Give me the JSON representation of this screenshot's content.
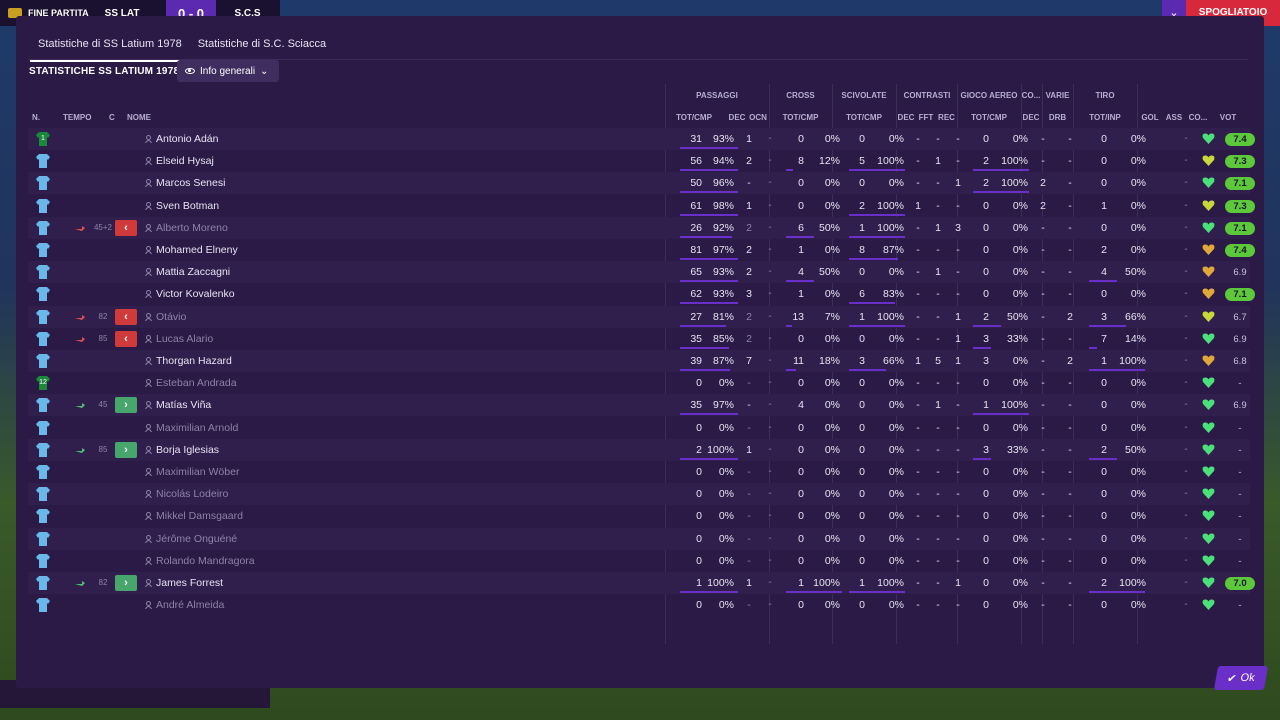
{
  "topbar": {
    "title": "FINE PARTITA",
    "home": "SS LAT",
    "score": "0 - 0",
    "away": "S.C.S",
    "skip": "SPOGLIATOIO"
  },
  "tabs": [
    "Statistiche di SS Latium 1978",
    "Statistiche di S.C. Sciacca"
  ],
  "subheader": "STATISTICHE SS LATIUM 1978",
  "dropdown": "Info generali",
  "groups": {
    "passaggi": "PASSAGGI",
    "cross": "CROSS",
    "scivolate": "SCIVOLATE",
    "contrasti": "CONTRASTI",
    "aereo": "GIOCO AEREO",
    "co": "CO...",
    "varie": "VARIE",
    "tiro": "TIRO"
  },
  "headers": {
    "n": "N.",
    "tempo": "TEMPO",
    "c": "C",
    "nome": "NOME",
    "totcmp": "TOT/CMP",
    "dec": "DEC",
    "ocn": "OCN",
    "cross": "TOT/CMP",
    "sciv": "TOT/CMP",
    "cdec": "DEC",
    "fft": "FFT",
    "rec": "REC",
    "aer": "TOT/CMP",
    "codec": "DEC",
    "drb": "DRB",
    "tiro": "TOT/INP",
    "gol": "GOL",
    "ass": "ASS",
    "cond": "CO...",
    "vot": "VOT"
  },
  "colors": {
    "accent": "#6a2fc8",
    "sub_out": "#d03a3a",
    "sub_in": "#47a66b",
    "rating": "#5cc93a"
  },
  "players": [
    {
      "num": "1",
      "gk": true,
      "name": "Antonio Adán",
      "played": true,
      "time": "",
      "sub": "",
      "pass": [
        "31",
        "93%"
      ],
      "pbar": 1,
      "pdec": "1",
      "pocn": "-",
      "cross": [
        "0",
        "0%"
      ],
      "cbar": 0,
      "sciv": [
        "0",
        "0%"
      ],
      "sbar": 0,
      "cdec": "-",
      "fft": "-",
      "rec": "-",
      "aer": [
        "0",
        "0%"
      ],
      "abar": 0,
      "codec": "-",
      "drb": "-",
      "tiro": [
        "0",
        "0%"
      ],
      "tbar": 0,
      "gol": "",
      "ass": "-",
      "heart": "g",
      "vot": "7.4",
      "votg": true
    },
    {
      "num": "",
      "gk": false,
      "name": "Elseid Hysaj",
      "played": true,
      "time": "",
      "sub": "",
      "pass": [
        "56",
        "94%"
      ],
      "pbar": 1,
      "pdec": "2",
      "pocn": "-",
      "cross": [
        "8",
        "12%"
      ],
      "cbar": 0.12,
      "sciv": [
        "5",
        "100%"
      ],
      "sbar": 1,
      "cdec": "-",
      "fft": "1",
      "rec": "-",
      "aer": [
        "2",
        "100%"
      ],
      "abar": 1,
      "codec": "-",
      "drb": "-",
      "tiro": [
        "0",
        "0%"
      ],
      "tbar": 0,
      "gol": "",
      "ass": "-",
      "heart": "y",
      "vot": "7.3",
      "votg": true
    },
    {
      "num": "",
      "gk": false,
      "name": "Marcos Senesi",
      "played": true,
      "time": "",
      "sub": "",
      "pass": [
        "50",
        "96%"
      ],
      "pbar": 1,
      "pdec": "-",
      "pocn": "-",
      "cross": [
        "0",
        "0%"
      ],
      "cbar": 0,
      "sciv": [
        "0",
        "0%"
      ],
      "sbar": 0,
      "cdec": "-",
      "fft": "-",
      "rec": "1",
      "aer": [
        "2",
        "100%"
      ],
      "abar": 1,
      "codec": "2",
      "drb": "-",
      "tiro": [
        "0",
        "0%"
      ],
      "tbar": 0,
      "gol": "",
      "ass": "-",
      "heart": "g",
      "vot": "7.1",
      "votg": true
    },
    {
      "num": "",
      "gk": false,
      "name": "Sven Botman",
      "played": true,
      "time": "",
      "sub": "",
      "pass": [
        "61",
        "98%"
      ],
      "pbar": 1,
      "pdec": "1",
      "pocn": "-",
      "cross": [
        "0",
        "0%"
      ],
      "cbar": 0,
      "sciv": [
        "2",
        "100%"
      ],
      "sbar": 1,
      "cdec": "1",
      "fft": "-",
      "rec": "-",
      "aer": [
        "0",
        "0%"
      ],
      "abar": 0,
      "codec": "2",
      "drb": "-",
      "tiro": [
        "1",
        "0%"
      ],
      "tbar": 0,
      "gol": "",
      "ass": "-",
      "heart": "y",
      "vot": "7.3",
      "votg": true
    },
    {
      "num": "",
      "gk": false,
      "name": "Alberto Moreno",
      "played": false,
      "time": "45+2",
      "sub": "out",
      "pass": [
        "26",
        "92%"
      ],
      "pbar": 0.9,
      "pdec": "2",
      "pocn": "-",
      "cross": [
        "6",
        "50%"
      ],
      "cbar": 0.5,
      "sciv": [
        "1",
        "100%"
      ],
      "sbar": 1,
      "cdec": "-",
      "fft": "1",
      "rec": "3",
      "aer": [
        "0",
        "0%"
      ],
      "abar": 0,
      "codec": "-",
      "drb": "-",
      "tiro": [
        "0",
        "0%"
      ],
      "tbar": 0,
      "gol": "",
      "ass": "-",
      "heart": "g",
      "vot": "7.1",
      "votg": true
    },
    {
      "num": "",
      "gk": false,
      "name": "Mohamed Elneny",
      "played": true,
      "time": "",
      "sub": "",
      "pass": [
        "81",
        "97%"
      ],
      "pbar": 1,
      "pdec": "2",
      "pocn": "-",
      "cross": [
        "1",
        "0%"
      ],
      "cbar": 0,
      "sciv": [
        "8",
        "87%"
      ],
      "sbar": 0.87,
      "cdec": "-",
      "fft": "-",
      "rec": "-",
      "aer": [
        "0",
        "0%"
      ],
      "abar": 0,
      "codec": "-",
      "drb": "-",
      "tiro": [
        "2",
        "0%"
      ],
      "tbar": 0,
      "gol": "",
      "ass": "-",
      "heart": "o",
      "vot": "7.4",
      "votg": true
    },
    {
      "num": "",
      "gk": false,
      "name": "Mattia Zaccagni",
      "played": true,
      "time": "",
      "sub": "",
      "pass": [
        "65",
        "93%"
      ],
      "pbar": 1,
      "pdec": "2",
      "pocn": "-",
      "cross": [
        "4",
        "50%"
      ],
      "cbar": 0.5,
      "sciv": [
        "0",
        "0%"
      ],
      "sbar": 0,
      "cdec": "-",
      "fft": "1",
      "rec": "-",
      "aer": [
        "0",
        "0%"
      ],
      "abar": 0,
      "codec": "-",
      "drb": "-",
      "tiro": [
        "4",
        "50%"
      ],
      "tbar": 0.5,
      "gol": "",
      "ass": "-",
      "heart": "o",
      "vot": "6.9",
      "votg": false
    },
    {
      "num": "",
      "gk": false,
      "name": "Victor Kovalenko",
      "played": true,
      "time": "",
      "sub": "",
      "pass": [
        "62",
        "93%"
      ],
      "pbar": 1,
      "pdec": "3",
      "pocn": "-",
      "cross": [
        "1",
        "0%"
      ],
      "cbar": 0,
      "sciv": [
        "6",
        "83%"
      ],
      "sbar": 0.83,
      "cdec": "-",
      "fft": "-",
      "rec": "-",
      "aer": [
        "0",
        "0%"
      ],
      "abar": 0,
      "codec": "-",
      "drb": "-",
      "tiro": [
        "0",
        "0%"
      ],
      "tbar": 0,
      "gol": "",
      "ass": "-",
      "heart": "o",
      "vot": "7.1",
      "votg": true
    },
    {
      "num": "",
      "gk": false,
      "name": "Otávio",
      "played": false,
      "time": "82",
      "sub": "out",
      "pass": [
        "27",
        "81%"
      ],
      "pbar": 0.8,
      "pdec": "2",
      "pocn": "-",
      "cross": [
        "13",
        "7%"
      ],
      "cbar": 0.07,
      "sciv": [
        "1",
        "100%"
      ],
      "sbar": 1,
      "cdec": "-",
      "fft": "-",
      "rec": "1",
      "aer": [
        "2",
        "50%"
      ],
      "abar": 0.5,
      "codec": "-",
      "drb": "2",
      "tiro": [
        "3",
        "66%"
      ],
      "tbar": 0.66,
      "gol": "",
      "ass": "-",
      "heart": "y",
      "vot": "6.7",
      "votg": false
    },
    {
      "num": "",
      "gk": false,
      "name": "Lucas Alario",
      "played": false,
      "time": "85",
      "sub": "out",
      "pass": [
        "35",
        "85%"
      ],
      "pbar": 0.85,
      "pdec": "2",
      "pocn": "-",
      "cross": [
        "0",
        "0%"
      ],
      "cbar": 0,
      "sciv": [
        "0",
        "0%"
      ],
      "sbar": 0,
      "cdec": "-",
      "fft": "-",
      "rec": "1",
      "aer": [
        "3",
        "33%"
      ],
      "abar": 0.33,
      "codec": "-",
      "drb": "-",
      "tiro": [
        "7",
        "14%"
      ],
      "tbar": 0.14,
      "gol": "",
      "ass": "-",
      "heart": "g",
      "vot": "6.9",
      "votg": false
    },
    {
      "num": "",
      "gk": false,
      "name": "Thorgan Hazard",
      "played": true,
      "time": "",
      "sub": "",
      "pass": [
        "39",
        "87%"
      ],
      "pbar": 0.87,
      "pdec": "7",
      "pocn": "-",
      "cross": [
        "11",
        "18%"
      ],
      "cbar": 0.18,
      "sciv": [
        "3",
        "66%"
      ],
      "sbar": 0.66,
      "cdec": "1",
      "fft": "5",
      "rec": "1",
      "aer": [
        "3",
        "0%"
      ],
      "abar": 0,
      "codec": "-",
      "drb": "2",
      "tiro": [
        "1",
        "100%"
      ],
      "tbar": 1,
      "gol": "",
      "ass": "-",
      "heart": "o",
      "vot": "6.8",
      "votg": false
    },
    {
      "num": "12",
      "gk": true,
      "name": "Esteban Andrada",
      "played": false,
      "time": "",
      "sub": "",
      "pass": [
        "0",
        "0%"
      ],
      "pbar": 0,
      "pdec": "-",
      "pocn": "-",
      "cross": [
        "0",
        "0%"
      ],
      "cbar": 0,
      "sciv": [
        "0",
        "0%"
      ],
      "sbar": 0,
      "cdec": "-",
      "fft": "-",
      "rec": "-",
      "aer": [
        "0",
        "0%"
      ],
      "abar": 0,
      "codec": "-",
      "drb": "-",
      "tiro": [
        "0",
        "0%"
      ],
      "tbar": 0,
      "gol": "",
      "ass": "-",
      "heart": "g",
      "vot": "-",
      "votg": false
    },
    {
      "num": "",
      "gk": false,
      "name": "Matías Viña",
      "played": true,
      "time": "45",
      "sub": "in",
      "pass": [
        "35",
        "97%"
      ],
      "pbar": 1,
      "pdec": "-",
      "pocn": "-",
      "cross": [
        "4",
        "0%"
      ],
      "cbar": 0,
      "sciv": [
        "0",
        "0%"
      ],
      "sbar": 0,
      "cdec": "-",
      "fft": "1",
      "rec": "-",
      "aer": [
        "1",
        "100%"
      ],
      "abar": 1,
      "codec": "-",
      "drb": "-",
      "tiro": [
        "0",
        "0%"
      ],
      "tbar": 0,
      "gol": "",
      "ass": "-",
      "heart": "g",
      "vot": "6.9",
      "votg": false
    },
    {
      "num": "",
      "gk": false,
      "name": "Maximilian Arnold",
      "played": false,
      "time": "",
      "sub": "",
      "pass": [
        "0",
        "0%"
      ],
      "pbar": 0,
      "pdec": "-",
      "pocn": "-",
      "cross": [
        "0",
        "0%"
      ],
      "cbar": 0,
      "sciv": [
        "0",
        "0%"
      ],
      "sbar": 0,
      "cdec": "-",
      "fft": "-",
      "rec": "-",
      "aer": [
        "0",
        "0%"
      ],
      "abar": 0,
      "codec": "-",
      "drb": "-",
      "tiro": [
        "0",
        "0%"
      ],
      "tbar": 0,
      "gol": "",
      "ass": "-",
      "heart": "g",
      "vot": "-",
      "votg": false
    },
    {
      "num": "",
      "gk": false,
      "name": "Borja Iglesias",
      "played": true,
      "time": "85",
      "sub": "in",
      "pass": [
        "2",
        "100%"
      ],
      "pbar": 1,
      "pdec": "1",
      "pocn": "-",
      "cross": [
        "0",
        "0%"
      ],
      "cbar": 0,
      "sciv": [
        "0",
        "0%"
      ],
      "sbar": 0,
      "cdec": "-",
      "fft": "-",
      "rec": "-",
      "aer": [
        "3",
        "33%"
      ],
      "abar": 0.33,
      "codec": "-",
      "drb": "-",
      "tiro": [
        "2",
        "50%"
      ],
      "tbar": 0.5,
      "gol": "",
      "ass": "-",
      "heart": "g",
      "vot": "-",
      "votg": false
    },
    {
      "num": "",
      "gk": false,
      "name": "Maximilian Wöber",
      "played": false,
      "time": "",
      "sub": "",
      "pass": [
        "0",
        "0%"
      ],
      "pbar": 0,
      "pdec": "-",
      "pocn": "-",
      "cross": [
        "0",
        "0%"
      ],
      "cbar": 0,
      "sciv": [
        "0",
        "0%"
      ],
      "sbar": 0,
      "cdec": "-",
      "fft": "-",
      "rec": "-",
      "aer": [
        "0",
        "0%"
      ],
      "abar": 0,
      "codec": "-",
      "drb": "-",
      "tiro": [
        "0",
        "0%"
      ],
      "tbar": 0,
      "gol": "",
      "ass": "-",
      "heart": "g",
      "vot": "-",
      "votg": false
    },
    {
      "num": "",
      "gk": false,
      "name": "Nicolás Lodeiro",
      "played": false,
      "time": "",
      "sub": "",
      "pass": [
        "0",
        "0%"
      ],
      "pbar": 0,
      "pdec": "-",
      "pocn": "-",
      "cross": [
        "0",
        "0%"
      ],
      "cbar": 0,
      "sciv": [
        "0",
        "0%"
      ],
      "sbar": 0,
      "cdec": "-",
      "fft": "-",
      "rec": "-",
      "aer": [
        "0",
        "0%"
      ],
      "abar": 0,
      "codec": "-",
      "drb": "-",
      "tiro": [
        "0",
        "0%"
      ],
      "tbar": 0,
      "gol": "",
      "ass": "-",
      "heart": "g",
      "vot": "-",
      "votg": false
    },
    {
      "num": "",
      "gk": false,
      "name": "Mikkel Damsgaard",
      "played": false,
      "time": "",
      "sub": "",
      "pass": [
        "0",
        "0%"
      ],
      "pbar": 0,
      "pdec": "-",
      "pocn": "-",
      "cross": [
        "0",
        "0%"
      ],
      "cbar": 0,
      "sciv": [
        "0",
        "0%"
      ],
      "sbar": 0,
      "cdec": "-",
      "fft": "-",
      "rec": "-",
      "aer": [
        "0",
        "0%"
      ],
      "abar": 0,
      "codec": "-",
      "drb": "-",
      "tiro": [
        "0",
        "0%"
      ],
      "tbar": 0,
      "gol": "",
      "ass": "-",
      "heart": "g",
      "vot": "-",
      "votg": false
    },
    {
      "num": "",
      "gk": false,
      "name": "Jérôme Onguéné",
      "played": false,
      "time": "",
      "sub": "",
      "pass": [
        "0",
        "0%"
      ],
      "pbar": 0,
      "pdec": "-",
      "pocn": "-",
      "cross": [
        "0",
        "0%"
      ],
      "cbar": 0,
      "sciv": [
        "0",
        "0%"
      ],
      "sbar": 0,
      "cdec": "-",
      "fft": "-",
      "rec": "-",
      "aer": [
        "0",
        "0%"
      ],
      "abar": 0,
      "codec": "-",
      "drb": "-",
      "tiro": [
        "0",
        "0%"
      ],
      "tbar": 0,
      "gol": "",
      "ass": "-",
      "heart": "g",
      "vot": "-",
      "votg": false
    },
    {
      "num": "",
      "gk": false,
      "name": "Rolando Mandragora",
      "played": false,
      "time": "",
      "sub": "",
      "pass": [
        "0",
        "0%"
      ],
      "pbar": 0,
      "pdec": "-",
      "pocn": "-",
      "cross": [
        "0",
        "0%"
      ],
      "cbar": 0,
      "sciv": [
        "0",
        "0%"
      ],
      "sbar": 0,
      "cdec": "-",
      "fft": "-",
      "rec": "-",
      "aer": [
        "0",
        "0%"
      ],
      "abar": 0,
      "codec": "-",
      "drb": "-",
      "tiro": [
        "0",
        "0%"
      ],
      "tbar": 0,
      "gol": "",
      "ass": "-",
      "heart": "g",
      "vot": "-",
      "votg": false
    },
    {
      "num": "",
      "gk": false,
      "name": "James Forrest",
      "played": true,
      "time": "82",
      "sub": "in",
      "pass": [
        "1",
        "100%"
      ],
      "pbar": 1,
      "pdec": "1",
      "pocn": "-",
      "cross": [
        "1",
        "100%"
      ],
      "cbar": 1,
      "sciv": [
        "1",
        "100%"
      ],
      "sbar": 1,
      "cdec": "-",
      "fft": "-",
      "rec": "1",
      "aer": [
        "0",
        "0%"
      ],
      "abar": 0,
      "codec": "-",
      "drb": "-",
      "tiro": [
        "2",
        "100%"
      ],
      "tbar": 1,
      "gol": "",
      "ass": "-",
      "heart": "g",
      "vot": "7.0",
      "votg": true
    },
    {
      "num": "",
      "gk": false,
      "name": "André Almeida",
      "played": false,
      "time": "",
      "sub": "",
      "pass": [
        "0",
        "0%"
      ],
      "pbar": 0,
      "pdec": "-",
      "pocn": "-",
      "cross": [
        "0",
        "0%"
      ],
      "cbar": 0,
      "sciv": [
        "0",
        "0%"
      ],
      "sbar": 0,
      "cdec": "-",
      "fft": "-",
      "rec": "-",
      "aer": [
        "0",
        "0%"
      ],
      "abar": 0,
      "codec": "-",
      "drb": "-",
      "tiro": [
        "0",
        "0%"
      ],
      "tbar": 0,
      "gol": "",
      "ass": "-",
      "heart": "g",
      "vot": "-",
      "votg": false
    }
  ],
  "ok_label": "Ok"
}
